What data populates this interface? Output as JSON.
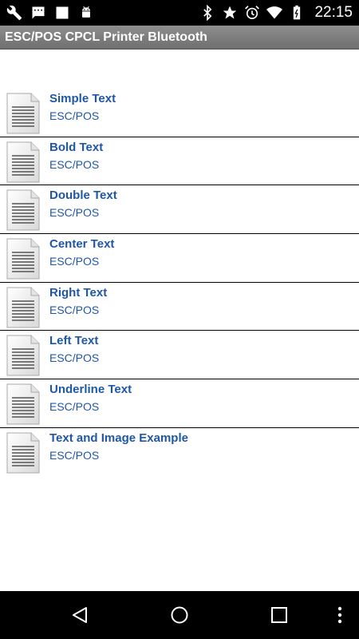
{
  "status_bar": {
    "time": "22:15",
    "left_icons": [
      "wrench-icon",
      "message-icon",
      "square-icon",
      "android-icon"
    ],
    "right_icons": [
      "bluetooth-icon",
      "star-icon",
      "alarm-icon",
      "wifi-icon",
      "battery-icon"
    ]
  },
  "app": {
    "title": "ESC/POS CPCL Printer Bluetooth"
  },
  "list": {
    "items": [
      {
        "title": "Simple Text",
        "subtitle": "ESC/POS"
      },
      {
        "title": "Bold Text",
        "subtitle": "ESC/POS"
      },
      {
        "title": "Double Text",
        "subtitle": "ESC/POS"
      },
      {
        "title": "Center Text",
        "subtitle": "ESC/POS"
      },
      {
        "title": "Right Text",
        "subtitle": "ESC/POS"
      },
      {
        "title": "Left Text",
        "subtitle": "ESC/POS"
      },
      {
        "title": "Underline Text",
        "subtitle": "ESC/POS"
      },
      {
        "title": "Text and Image Example",
        "subtitle": "ESC/POS"
      }
    ]
  },
  "nav_bar": {
    "buttons": [
      "back-icon",
      "home-icon",
      "recents-icon",
      "menu-icon"
    ]
  },
  "colors": {
    "accent_text": "#1f57a8",
    "title_bar": "#7f7f7f",
    "status_bar": "#000000"
  }
}
